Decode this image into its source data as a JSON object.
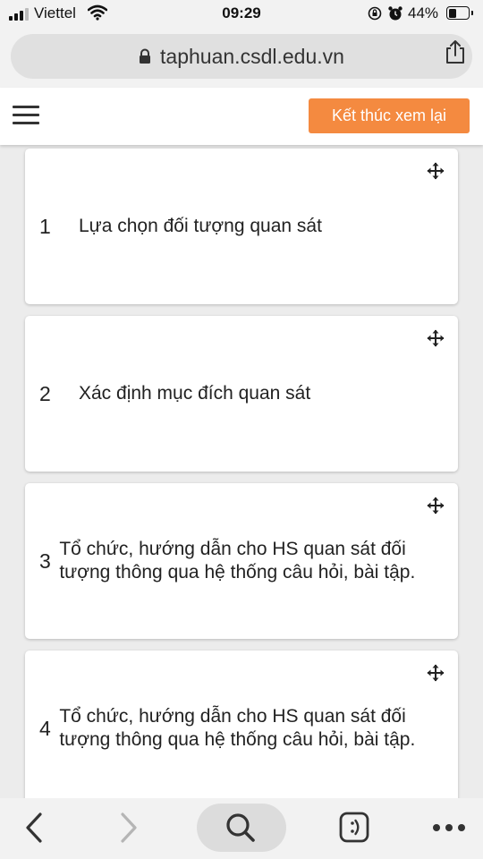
{
  "status_bar": {
    "carrier": "Viettel",
    "time": "09:29",
    "battery_percent": "44%",
    "battery_level": 0.44
  },
  "browser": {
    "url": "taphuan.csdl.edu.vn"
  },
  "header": {
    "menu_icon": "hamburger-icon",
    "end_review_label": "Kết thúc xem lại",
    "accent_color": "#f48a40"
  },
  "items": [
    {
      "number": "1",
      "text": "Lựa chọn đối tượng quan sát"
    },
    {
      "number": "2",
      "text": "Xác định mục đích quan sát"
    },
    {
      "number": "3",
      "text": "Tổ chức, hướng dẫn cho HS quan sát đối tượng thông qua hệ thống câu hỏi, bài tập."
    },
    {
      "number": "4",
      "text": "Tổ chức, hướng dẫn cho HS quan sát đối tượng thông qua hệ thống câu hỏi, bài tập."
    }
  ],
  "toolbar": {
    "icons": [
      "back-icon",
      "forward-icon",
      "search-icon",
      "reader-icon",
      "more-icon"
    ]
  }
}
